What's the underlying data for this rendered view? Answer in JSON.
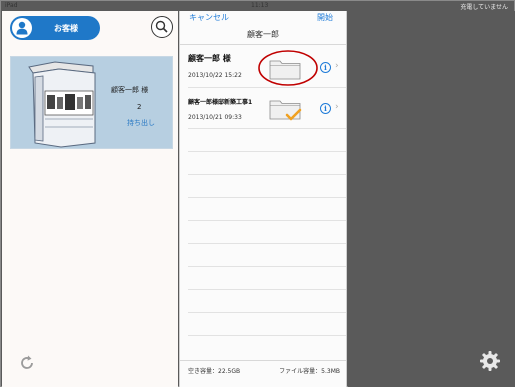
{
  "status_bar": {
    "device": "iPad",
    "time": "11:13",
    "charging": "充電していません"
  },
  "left_panel": {
    "customer_button": "お客様",
    "card": {
      "customer_name": "顧客一郎 様",
      "count": "2",
      "takeout_label": "持ち出し"
    }
  },
  "middle_panel": {
    "cancel_label": "キャンセル",
    "open_label": "開始",
    "title": "顧客一郎",
    "rows": [
      {
        "title": "顧客一郎 様",
        "date": "2013/10/22 15:22",
        "checked": false
      },
      {
        "title": "顧客一郎様邸新築工事1",
        "date": "2013/10/21 09:33",
        "checked": true
      }
    ],
    "footer": {
      "free_space": "空き容量：22.5GB",
      "file_size": "ファイル容量：5.3MB"
    }
  },
  "icons": [
    "user-icon",
    "search-icon",
    "binder-icon",
    "refresh-icon",
    "folder-icon",
    "check-icon",
    "info-icon",
    "chevron-right-icon",
    "gear-icon"
  ],
  "colors": {
    "accent": "#1f78c8",
    "card_bg": "#b7cfe1",
    "highlight_circle": "#c00000",
    "check": "#f0a020",
    "right_bg": "#5a5a5a"
  }
}
